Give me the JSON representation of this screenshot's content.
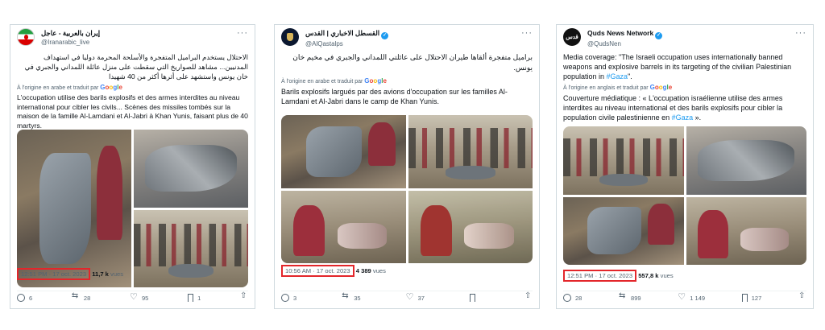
{
  "colors": {
    "highlight_box": "#e3262b",
    "link": "#1d9bf0",
    "muted": "#536471",
    "verified": "#1d9bf0"
  },
  "google_logo": [
    "G",
    "o",
    "o",
    "g",
    "l",
    "e"
  ],
  "tweets": [
    {
      "display_name": "إيران بالعربية - عاجل",
      "handle": "@Iranarabic_live",
      "avatar_icon": "iran-flag-icon",
      "verified": false,
      "original_text": "الاحتلال يستخدم البراميل المتفجرة والأسلحة المحرمة دوليا في استهداف المدنيين... مشاهد للصواريخ التي سقطت على منزل عائلة اللمداني والجبري في خان يونس واستشهد على أثرها أكثر من 40 شهيدا",
      "translated_label": "À l'origine en arabe et traduit par",
      "translation": "L'occupation utilise des barils explosifs et des armes interdites au niveau international pour cibler les civils... Scènes des missiles tombés sur la maison de la famille Al-Lamdani et Al-Jabri à Khan Yunis, faisant plus de 40 martyrs.",
      "timestamp": "12:51 PM · 17 oct. 2023",
      "views_count": "11,7 k",
      "views_label": "vues",
      "counts": {
        "reply": "6",
        "retweet": "28",
        "like": "95",
        "bookmark": "1"
      }
    },
    {
      "display_name": "القسطل الاخباري | القدس",
      "handle": "@AlQastalps",
      "avatar_icon": "qastal-logo-icon",
      "verified": true,
      "original_text": "براميل متفجرة ألقاها طيران الاحتلال على عائلتي اللمداني والجبري في مخيم خان يونس.",
      "translated_label": "À l'origine en arabe et traduit par",
      "translation": "Barils explosifs largués par des avions d'occupation sur les familles Al-Lamdani et Al-Jabri dans le camp de Khan Yunis.",
      "timestamp": "10:56 AM · 17 oct. 2023",
      "views_count": "4 389",
      "views_label": "vues",
      "counts": {
        "reply": "3",
        "retweet": "35",
        "like": "37",
        "bookmark": ""
      }
    },
    {
      "display_name": "Quds News Network",
      "handle": "@QudsNen",
      "avatar_icon": "quds-logo-icon",
      "avatar_text": "قدس",
      "verified": true,
      "original_text_before": "Media coverage: \"The Israeli occupation uses internationally banned weapons and explosive barrels in its targeting of the civilian Palestinian population in ",
      "original_hashtag": "#Gaza",
      "original_text_after": "\".",
      "translated_label": "À l'origine en anglais et traduit par",
      "translation_before": "Couverture médiatique : « L'occupation israélienne utilise des armes interdites au niveau international et des barils explosifs pour cibler la population civile palestinienne en ",
      "translation_hashtag": "#Gaza",
      "translation_after": " ».",
      "timestamp": "12:51 PM · 17 oct. 2023",
      "views_count": "557,8 k",
      "views_label": "vues",
      "counts": {
        "reply": "28",
        "retweet": "899",
        "like": "1 149",
        "bookmark": "127"
      }
    }
  ]
}
